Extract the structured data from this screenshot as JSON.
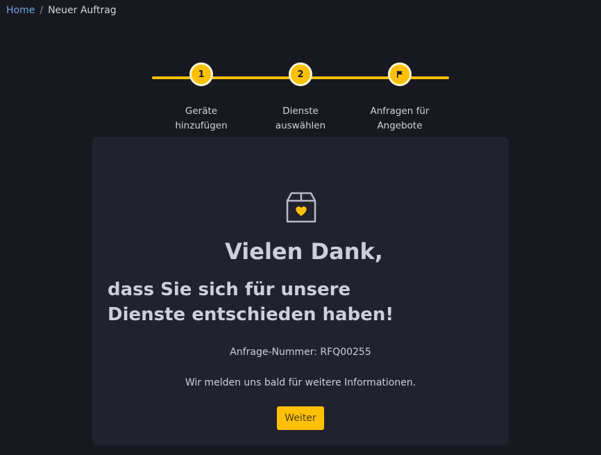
{
  "breadcrumb": {
    "home": "Home",
    "separator": "/",
    "current": "Neuer Auftrag"
  },
  "stepper": {
    "steps": [
      {
        "marker": "1",
        "label": "Geräte hinzufügen"
      },
      {
        "marker": "2",
        "label": "Dienste auswählen"
      },
      {
        "marker": "flag-icon",
        "label": "Anfragen für Angebote"
      }
    ],
    "accent": "#ffc107"
  },
  "confirmation": {
    "icon": "box-heart-icon",
    "title": "Vielen Dank,",
    "subtitle": "dass Sie sich für unsere Dienste entschieden haben!",
    "request_number": "Anfrage-Nummer: RFQ00255",
    "info": "Wir melden uns bald für weitere Informationen.",
    "continue_label": "Weiter"
  }
}
